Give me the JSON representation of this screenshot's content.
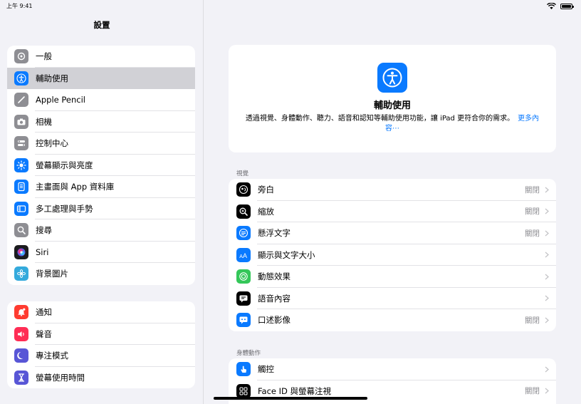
{
  "status": {
    "time": "上午 9:41"
  },
  "sidebar": {
    "title": "設置",
    "group1": [
      {
        "label": "一般",
        "icon": "gear-icon",
        "color": "#8e8e93"
      },
      {
        "label": "輔助使用",
        "icon": "accessibility-icon",
        "color": "#0a7aff",
        "selected": true
      },
      {
        "label": "Apple Pencil",
        "icon": "pencil-icon",
        "color": "#8e8e93"
      },
      {
        "label": "相機",
        "icon": "camera-icon",
        "color": "#8e8e93"
      },
      {
        "label": "控制中心",
        "icon": "control-center-icon",
        "color": "#8e8e93"
      },
      {
        "label": "螢幕顯示與亮度",
        "icon": "sun-icon",
        "color": "#0a7aff"
      },
      {
        "label": "主畫面與 App 資料庫",
        "icon": "home-screen-icon",
        "color": "#0a7aff"
      },
      {
        "label": "多工處理與手勢",
        "icon": "multitask-icon",
        "color": "#0a7aff"
      },
      {
        "label": "搜尋",
        "icon": "search-icon",
        "color": "#8e8e93"
      },
      {
        "label": "Siri",
        "icon": "siri-icon",
        "color": "#1c1c1e"
      },
      {
        "label": "背景圖片",
        "icon": "wallpaper-icon",
        "color": "#34aadc"
      }
    ],
    "group2": [
      {
        "label": "通知",
        "icon": "bell-icon",
        "color": "#ff3b30"
      },
      {
        "label": "聲音",
        "icon": "speaker-icon",
        "color": "#ff2d55"
      },
      {
        "label": "專注模式",
        "icon": "moon-icon",
        "color": "#5856d6"
      },
      {
        "label": "螢幕使用時間",
        "icon": "hourglass-icon",
        "color": "#5856d6"
      }
    ]
  },
  "hero": {
    "title": "輔助使用",
    "description": "透過視覺、身體動作、聽力、語音和認知等輔助使用功能，讓 iPad 更符合你的需求。",
    "more": "更多內容⋯"
  },
  "sections": [
    {
      "header": "視覺",
      "rows": [
        {
          "label": "旁白",
          "value": "關閉",
          "icon": "voiceover-icon",
          "color": "#000000"
        },
        {
          "label": "縮放",
          "value": "關閉",
          "icon": "zoom-icon",
          "color": "#000000"
        },
        {
          "label": "懸浮文字",
          "value": "關閉",
          "icon": "hover-text-icon",
          "color": "#0a7aff"
        },
        {
          "label": "顯示與文字大小",
          "value": "",
          "icon": "text-size-icon",
          "color": "#0a7aff"
        },
        {
          "label": "動態效果",
          "value": "",
          "icon": "motion-icon",
          "color": "#34c759"
        },
        {
          "label": "語音內容",
          "value": "",
          "icon": "spoken-content-icon",
          "color": "#000000"
        },
        {
          "label": "口述影像",
          "value": "關閉",
          "icon": "audio-description-icon",
          "color": "#0a7aff"
        }
      ]
    },
    {
      "header": "身體動作",
      "rows": [
        {
          "label": "觸控",
          "value": "",
          "icon": "touch-icon",
          "color": "#0a7aff"
        },
        {
          "label": "Face ID 與螢幕注視",
          "value": "關閉",
          "icon": "face-id-icon",
          "color": "#000000"
        }
      ]
    }
  ]
}
